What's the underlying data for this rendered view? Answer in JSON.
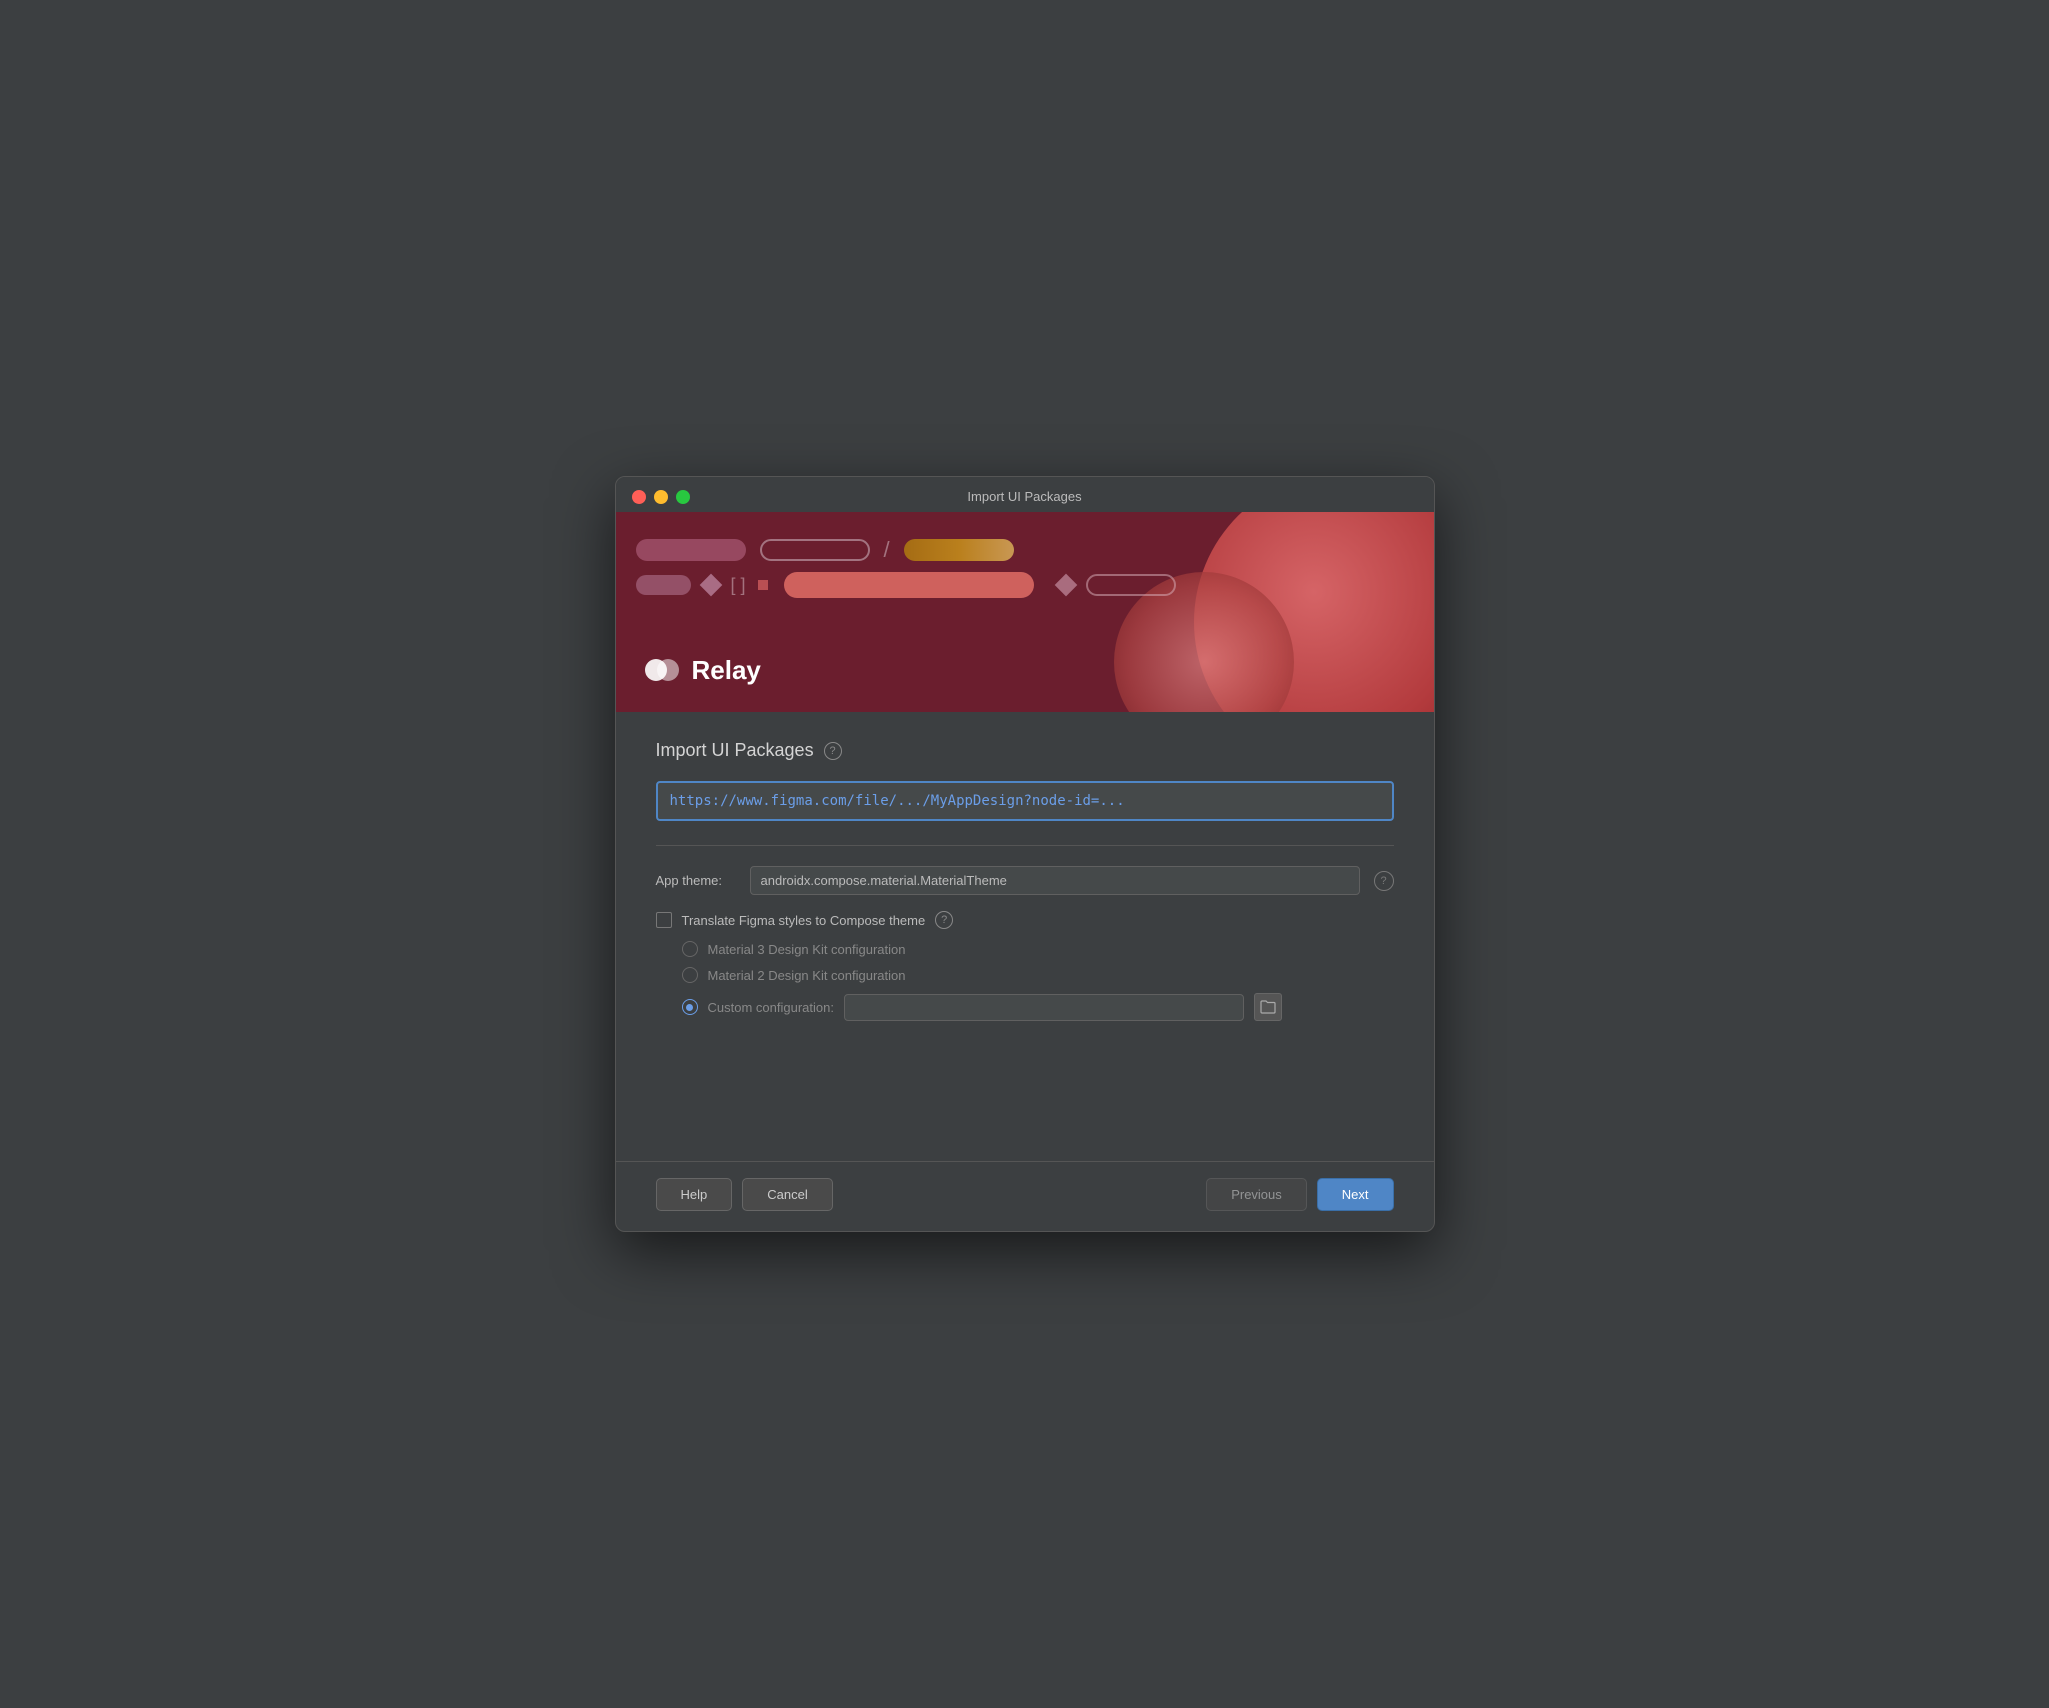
{
  "window": {
    "title": "Import UI Packages"
  },
  "hero": {
    "logo_text": "Relay"
  },
  "content": {
    "section_title": "Import UI Packages",
    "help_tooltip": "?",
    "url_placeholder": "https://www.figma.com/file/.../MyAppDesign?node-id=...",
    "url_value": "https://www.figma.com/file/.../MyAppDesign?node-id=...",
    "app_theme_label": "App theme:",
    "app_theme_value": "androidx.compose.material.MaterialTheme",
    "translate_label": "Translate Figma styles to Compose theme",
    "radio_material3": "Material 3 Design Kit configuration",
    "radio_material2": "Material 2 Design Kit configuration",
    "radio_custom": "Custom configuration:"
  },
  "footer": {
    "help_label": "Help",
    "cancel_label": "Cancel",
    "previous_label": "Previous",
    "next_label": "Next"
  }
}
